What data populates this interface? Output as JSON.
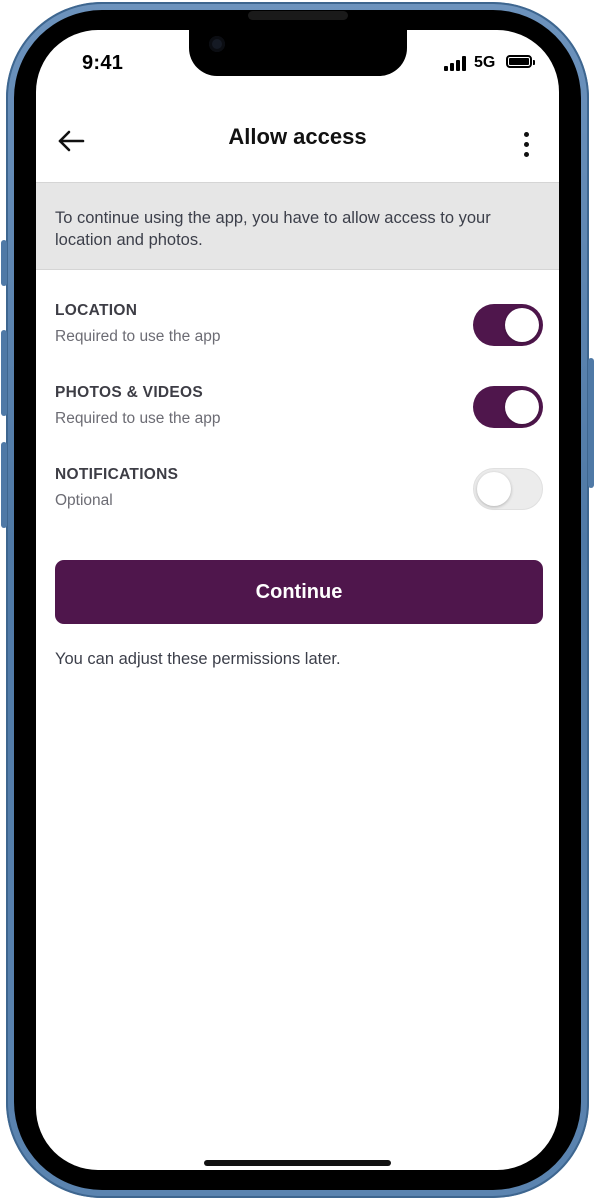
{
  "status_bar": {
    "time": "9:41",
    "network": "5G"
  },
  "header": {
    "title": "Allow access",
    "back_icon": "arrow-left-icon",
    "menu_icon": "more-vertical-icon"
  },
  "banner": {
    "text": "To continue using the app, you have to allow access to your location and photos."
  },
  "permissions": [
    {
      "title": "LOCATION",
      "subtitle": "Required to use the app",
      "enabled": true
    },
    {
      "title": "PHOTOS & VIDEOS",
      "subtitle": "Required to use the app",
      "enabled": true
    },
    {
      "title": "NOTIFICATIONS",
      "subtitle": "Optional",
      "enabled": false
    }
  ],
  "continue_label": "Continue",
  "footnote": "You can adjust these permissions later.",
  "colors": {
    "accent": "#4f164c",
    "frame": "#5b84b0",
    "banner_bg": "#e6e6e6",
    "toggle_off": "#ececec"
  }
}
